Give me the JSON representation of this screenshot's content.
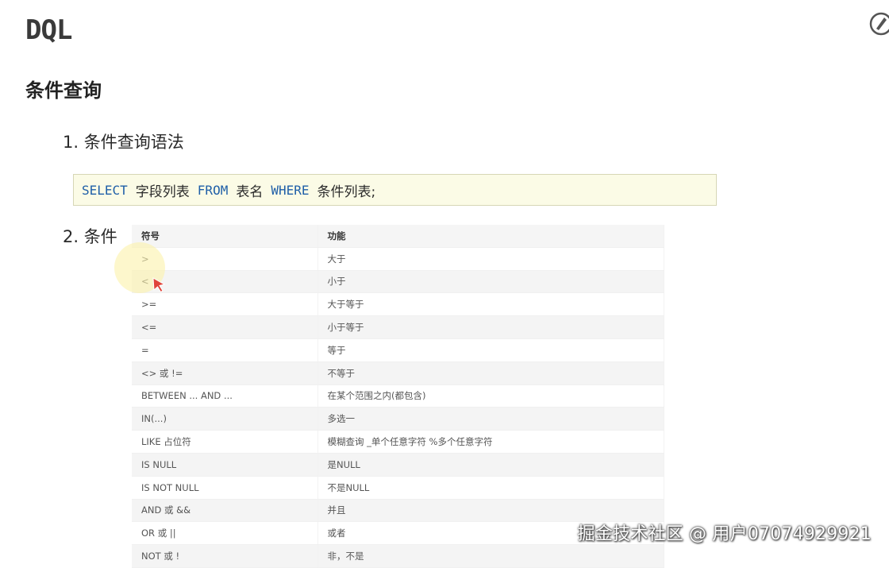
{
  "document": {
    "title": "DQL",
    "section_title": "条件查询",
    "steps": [
      {
        "label": "1. 条件查询语法"
      },
      {
        "label": "2. 条件"
      }
    ],
    "code": {
      "kw_select": "SELECT",
      "field_list": "字段列表",
      "kw_from": "FROM",
      "table_name": "表名",
      "kw_where": "WHERE",
      "condition_list": "条件列表;"
    }
  },
  "conditions_table": {
    "headers": [
      "符号",
      "功能"
    ],
    "rows": [
      [
        ">",
        "大于"
      ],
      [
        "<",
        "小于"
      ],
      [
        ">=",
        "大于等于"
      ],
      [
        "<=",
        "小于等于"
      ],
      [
        "=",
        "等于"
      ],
      [
        "<> 或 !=",
        "不等于"
      ],
      [
        "BETWEEN ... AND ...",
        "在某个范围之内(都包含)"
      ],
      [
        "IN(...)",
        "多选一"
      ],
      [
        "LIKE 占位符",
        "模糊查询 _单个任意字符 %多个任意字符"
      ],
      [
        "IS NULL",
        "是NULL"
      ],
      [
        "IS NOT NULL",
        "不是NULL"
      ],
      [
        "AND 或 &&",
        "并且"
      ],
      [
        "OR 或 ||",
        "或者"
      ],
      [
        "NOT 或 !",
        "非，不是"
      ]
    ]
  },
  "watermark": "掘金技术社区 @ 用户07074929921",
  "colors": {
    "code_background": "#fbfbe6",
    "code_keyword": "#1f5fa8",
    "cursor": "#e0443a"
  },
  "icons": [
    "logo-icon",
    "cursor-arrow-icon"
  ]
}
